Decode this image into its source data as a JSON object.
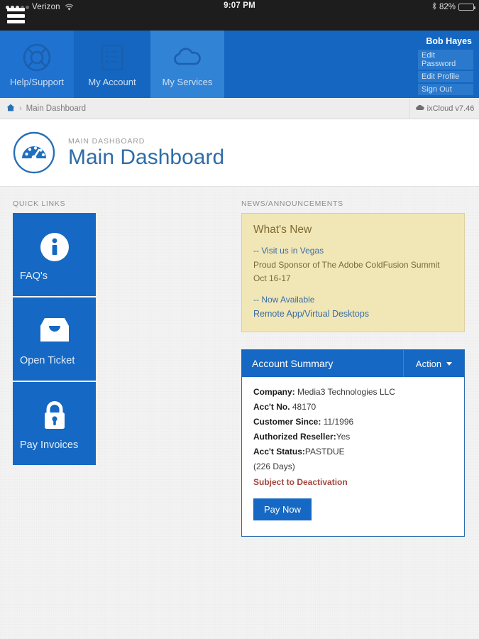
{
  "statusbar": {
    "carrier": "Verizon",
    "time": "9:07 PM",
    "battery_pct": "82%",
    "signal_dots_filled": 3,
    "signal_dots_total": 5
  },
  "topnav": {
    "tiles": [
      {
        "label": "Help/Support",
        "icon": "lifebuoy-icon"
      },
      {
        "label": "My Account",
        "icon": "list-document-icon"
      },
      {
        "label": "My Services",
        "icon": "cloud-icon"
      }
    ]
  },
  "usermenu": {
    "name": "Bob Hayes",
    "links": [
      {
        "label": "Edit Password"
      },
      {
        "label": "Edit Profile"
      },
      {
        "label": "Sign Out"
      }
    ]
  },
  "breadcrumb": {
    "home_icon": "home-icon",
    "separator": "›",
    "current": "Main Dashboard",
    "version_icon": "cloud-icon",
    "version": "ixCloud v7.46"
  },
  "pageheader": {
    "icon": "dashboard-gauge-icon",
    "eyebrow": "MAIN DASHBOARD",
    "title": "Main Dashboard"
  },
  "quicklinks": {
    "label": "QUICK LINKS",
    "tiles": [
      {
        "label": "FAQ's",
        "icon": "info-circle-icon"
      },
      {
        "label": "Open Ticket",
        "icon": "inbox-icon"
      },
      {
        "label": "Pay Invoices",
        "icon": "lock-icon"
      }
    ]
  },
  "news": {
    "label": "NEWS/ANNOUNCEMENTS",
    "title": "What's New",
    "item1_link": "-- Visit us in Vegas",
    "item1_line1": "Proud Sponsor of The Adobe ColdFusion Summit",
    "item1_line2": "Oct 16-17",
    "item2_link": "-- Now Available",
    "item2_line1": "Remote App/Virtual Desktops"
  },
  "account": {
    "title": "Account Summary",
    "action_label": "Action",
    "rows": [
      {
        "label": "Company:",
        "value": " Media3 Technologies LLC"
      },
      {
        "label": "Acc't No.",
        "value": " 48170"
      },
      {
        "label": "Customer Since:",
        "value": " 11/1996"
      },
      {
        "label": "Authorized Reseller:",
        "value": "Yes"
      },
      {
        "label": "Acc't Status:",
        "value": "PASTDUE"
      }
    ],
    "days": "(226 Days)",
    "warning": "Subject to Deactivation",
    "pay_button": "Pay Now"
  },
  "colors": {
    "brand_blue": "#1568c3",
    "nav_blue": "#1466c0",
    "news_bg": "#f1e6b6",
    "warning_red": "#a4453c",
    "title_blue": "#2f6ca8"
  }
}
